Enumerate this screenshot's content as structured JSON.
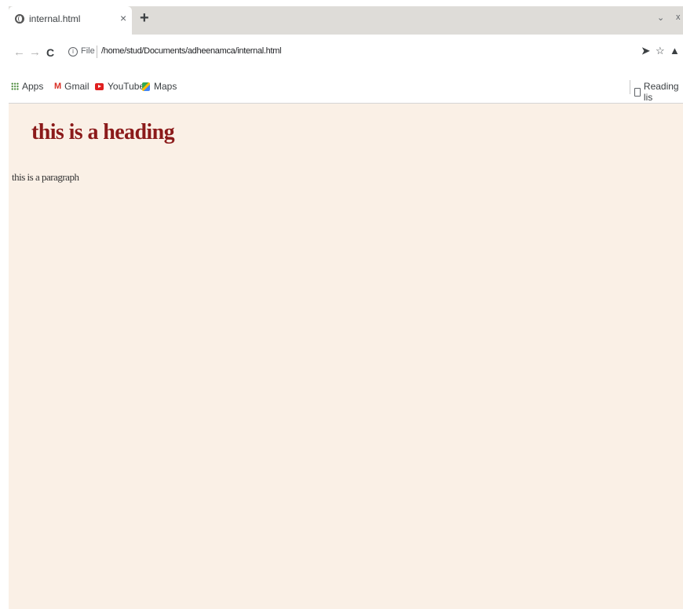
{
  "tab": {
    "title": "internal.html",
    "close_glyph": "×",
    "favicon": "globe-icon"
  },
  "tabstrip": {
    "new_tab_glyph": "+",
    "search_tabs_glyph": "⌄",
    "close_window_glyph": "x"
  },
  "toolbar": {
    "back_glyph": "←",
    "forward_glyph": "→",
    "reload_glyph": "C",
    "scheme_label": "File",
    "url": "/home/stud/Documents/adheenamca/internal.html",
    "share_glyph": "➤",
    "star_glyph": "☆",
    "profile_glyph": "👤",
    "menu_glyph": "⋮"
  },
  "bookmarks": {
    "apps": "Apps",
    "gmail": "Gmail",
    "youtube": "YouTube",
    "maps": "Maps",
    "reading_list": "Reading lis"
  },
  "page": {
    "heading": "this is a heading",
    "paragraph": "this is a paragraph",
    "background_color": "#faf0e6",
    "heading_color": "#8b1a1a"
  }
}
